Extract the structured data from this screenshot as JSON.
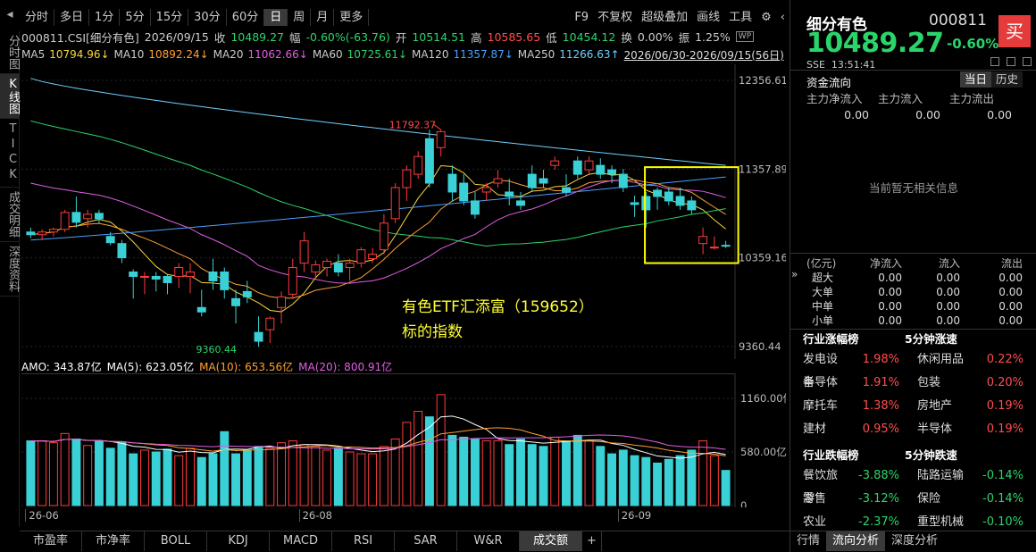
{
  "left_tabs": [
    "分时图",
    "K线图",
    "TICK",
    "成交明细",
    "深度资料"
  ],
  "left_active": 1,
  "period_tabs": [
    "分时",
    "多日",
    "1分",
    "5分",
    "15分",
    "30分",
    "60分",
    "日",
    "周",
    "月",
    "更多"
  ],
  "period_active": 7,
  "period_right": [
    "F9",
    "不复权",
    "超级叠加",
    "画线",
    "工具"
  ],
  "info": {
    "code": "000811.CSI[细分有色]",
    "date": "2026/09/15",
    "close_label": "收",
    "close": "10489.27",
    "amp_label": "幅",
    "amp": "-0.60%(-63.76)",
    "open_label": "开",
    "open": "10514.51",
    "high_label": "高",
    "high": "10585.65",
    "low_label": "低",
    "low": "10454.12",
    "turnover_label": "换",
    "turnover": "0.00%",
    "swing_label": "振",
    "swing": "1.25%"
  },
  "ma": [
    {
      "label": "MA5",
      "value": "10794.96↓",
      "color": "#f5d640"
    },
    {
      "label": "MA10",
      "value": "10892.24↓",
      "color": "#ffa030"
    },
    {
      "label": "MA20",
      "value": "11062.66↓",
      "color": "#e25ee2"
    },
    {
      "label": "MA60",
      "value": "10725.61↓",
      "color": "#2bd46a"
    },
    {
      "label": "MA120",
      "value": "11357.87↓",
      "color": "#4aa0ff"
    },
    {
      "label": "MA250",
      "value": "11266.63↑",
      "color": "#6fd0ff"
    }
  ],
  "range": "2026/06/30-2026/09/15(56日)",
  "price_axis": [
    "12356.61",
    "11357.89",
    "10359.16",
    "9360.44"
  ],
  "peak_label": "11792.37",
  "low_label_chart": "9360.44",
  "annotation": [
    "有色ETF汇添富（159652）",
    "标的指数"
  ],
  "amo": {
    "amo": "AMO: 343.87亿",
    "ma5": "MA(5): 623.05亿",
    "ma10": "MA(10): 653.56亿",
    "ma20": "MA(20): 800.91亿"
  },
  "vol_axis": [
    "1160.00亿",
    "580.00亿",
    "0"
  ],
  "x_labels": [
    "26-06",
    "26-08",
    "26-09"
  ],
  "bottom_tabs": [
    "市盈率",
    "市净率",
    "BOLL",
    "KDJ",
    "MACD",
    "RSI",
    "SAR",
    "W&R",
    "成交额",
    "+"
  ],
  "bottom_active": 8,
  "right": {
    "name": "细分有色",
    "code": "000811",
    "buy": "买",
    "price": "10489.27",
    "pct": "-0.60%",
    "exchange": "SSE",
    "time": "13:51:41",
    "flow_title": "资金流向",
    "flow_tabs": [
      "当日",
      "历史"
    ],
    "flow_headers": [
      "主力净流入",
      "主力流入",
      "主力流出"
    ],
    "flow_values": [
      "0.00",
      "0.00",
      "0.00"
    ],
    "no_info": "当前暂无相关信息",
    "table_headers": [
      "(亿元)",
      "净流入",
      "流入",
      "流出"
    ],
    "table_rows": [
      [
        "超大",
        "0.00",
        "0.00",
        "0.00"
      ],
      [
        "大单",
        "0.00",
        "0.00",
        "0.00"
      ],
      [
        "中单",
        "0.00",
        "0.00",
        "0.00"
      ],
      [
        "小单",
        "0.00",
        "0.00",
        "0.00"
      ]
    ],
    "rise_title": "行业涨幅榜",
    "rise5_title": "5分钟涨速",
    "rise_rows": [
      [
        "发电设备",
        "1.98%",
        "休闲用品",
        "0.22%"
      ],
      [
        "半导体",
        "1.91%",
        "包装",
        "0.20%"
      ],
      [
        "摩托车",
        "1.38%",
        "房地产",
        "0.19%"
      ],
      [
        "建材",
        "0.95%",
        "半导体",
        "0.19%"
      ]
    ],
    "fall_title": "行业跌幅榜",
    "fall5_title": "5分钟跌速",
    "fall_rows": [
      [
        "餐饮旅游",
        "-3.88%",
        "陆路运输",
        "-0.14%"
      ],
      [
        "零售",
        "-3.12%",
        "保险",
        "-0.14%"
      ],
      [
        "农业",
        "-2.37%",
        "重型机械",
        "-0.10%"
      ]
    ],
    "bottom_tabs": [
      "行情",
      "流向分析",
      "深度分析"
    ],
    "bottom_active": 1
  },
  "chart_data": {
    "type": "candlestick",
    "ylim": [
      9360.44,
      12356.61
    ],
    "candles": [
      [
        10650,
        10700,
        10580,
        10620
      ],
      [
        10620,
        10680,
        10560,
        10650
      ],
      [
        10650,
        10700,
        10600,
        10680
      ],
      [
        10680,
        10900,
        10650,
        10870
      ],
      [
        10870,
        11050,
        10700,
        10760
      ],
      [
        10800,
        10900,
        10700,
        10850
      ],
      [
        10860,
        10900,
        10750,
        10800
      ],
      [
        10600,
        10650,
        10500,
        10530
      ],
      [
        10520,
        10560,
        10300,
        10360
      ],
      [
        10200,
        10230,
        9900,
        10150
      ],
      [
        10150,
        10200,
        9950,
        10150
      ],
      [
        10150,
        10200,
        9980,
        10120
      ],
      [
        10150,
        10180,
        9950,
        10080
      ],
      [
        10150,
        10300,
        10020,
        10250
      ],
      [
        10150,
        10300,
        9960,
        10200
      ],
      [
        9800,
        10000,
        9700,
        9750
      ],
      [
        10200,
        10350,
        10000,
        10100
      ],
      [
        10200,
        10250,
        9900,
        10000
      ],
      [
        9900,
        10000,
        9620,
        9820
      ],
      [
        9980,
        10100,
        9850,
        9920
      ],
      [
        9520,
        9700,
        9360,
        9420
      ],
      [
        9550,
        9700,
        9400,
        9680
      ],
      [
        9800,
        9980,
        9620,
        9920
      ],
      [
        9950,
        10350,
        9900,
        10250
      ],
      [
        10300,
        10650,
        10200,
        10550
      ],
      [
        10200,
        10330,
        10120,
        10280
      ],
      [
        10250,
        10350,
        10150,
        10320
      ],
      [
        10300,
        10400,
        10150,
        10200
      ],
      [
        10250,
        10350,
        10100,
        10300
      ],
      [
        10300,
        10480,
        10250,
        10450
      ],
      [
        10350,
        10470,
        10300,
        10400
      ],
      [
        10450,
        10850,
        10400,
        10750
      ],
      [
        10800,
        11200,
        10750,
        11150
      ],
      [
        11150,
        11400,
        11000,
        11350
      ],
      [
        11300,
        11560,
        11250,
        11500
      ],
      [
        11700,
        11800,
        11150,
        11200
      ],
      [
        11600,
        11800,
        11500,
        11780
      ],
      [
        11300,
        11400,
        11000,
        11100
      ],
      [
        11200,
        11300,
        10950,
        11000
      ],
      [
        11000,
        11100,
        10800,
        10850
      ],
      [
        11100,
        11200,
        11000,
        11150
      ],
      [
        11200,
        11350,
        11150,
        11250
      ],
      [
        11100,
        11250,
        10950,
        11050
      ],
      [
        11000,
        11100,
        10900,
        10950
      ],
      [
        11300,
        11400,
        11100,
        11150
      ],
      [
        11250,
        11350,
        11150,
        11200
      ],
      [
        11400,
        11500,
        11350,
        11450
      ],
      [
        11150,
        11300,
        11050,
        11100
      ],
      [
        11450,
        11500,
        11250,
        11300
      ],
      [
        11350,
        11500,
        11300,
        11450
      ],
      [
        11400,
        11480,
        11250,
        11300
      ],
      [
        11350,
        11400,
        11200,
        11300
      ],
      [
        11300,
        11360,
        11100,
        11150
      ],
      [
        10980,
        11060,
        10820,
        10960
      ],
      [
        11050,
        11100,
        10700,
        10900
      ],
      [
        11120,
        11150,
        10900,
        11050
      ],
      [
        11100,
        11150,
        10950,
        11000
      ],
      [
        11050,
        11150,
        10900,
        10950
      ],
      [
        11000,
        11050,
        10850,
        10900
      ],
      [
        10520,
        10700,
        10400,
        10600
      ],
      [
        10480,
        10600,
        10450,
        10480
      ],
      [
        10500,
        10550,
        10470,
        10490
      ]
    ],
    "volumes": [
      700,
      700,
      680,
      780,
      720,
      650,
      700,
      620,
      680,
      560,
      600,
      580,
      610,
      540,
      620,
      520,
      560,
      800,
      560,
      600,
      640,
      620,
      680,
      700,
      660,
      640,
      600,
      620,
      580,
      560,
      560,
      640,
      720,
      900,
      1020,
      960,
      1200,
      760,
      740,
      720,
      700,
      700,
      660,
      720,
      660,
      640,
      740,
      700,
      760,
      700,
      640,
      560,
      600,
      540,
      520,
      460,
      500,
      540,
      600,
      700,
      540,
      380
    ],
    "vol_ylim": [
      0,
      1160
    ]
  }
}
